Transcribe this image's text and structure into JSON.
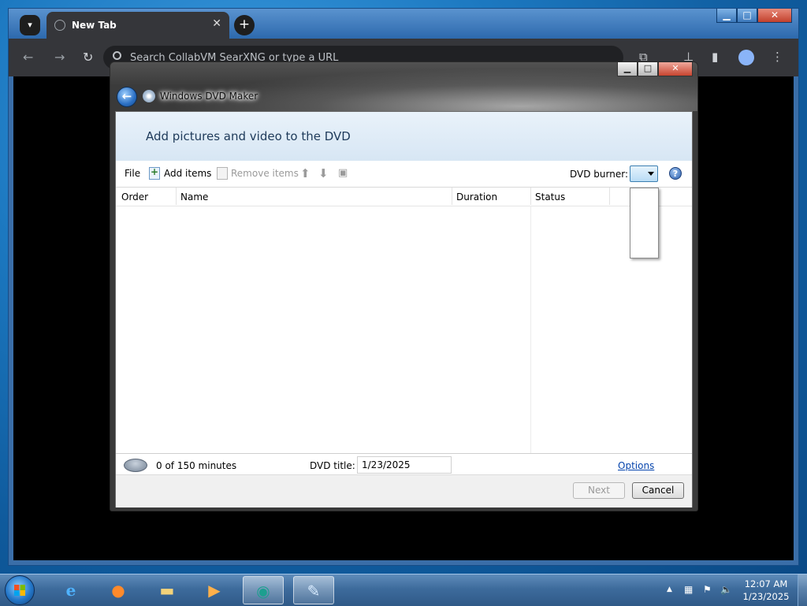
{
  "browser": {
    "tab_title": "New Tab",
    "omnibox_placeholder": "Search CollabVM SearXNG or type a URL",
    "window_buttons": {
      "minimize": "▁",
      "maximize": "□",
      "close": "✕"
    }
  },
  "dvd_maker": {
    "window_title": "Windows DVD Maker",
    "caption_buttons": {
      "minimize": "▁",
      "maximize": "□",
      "close": "✕"
    },
    "heading": "Add pictures and video to the DVD",
    "commands": {
      "file": "File",
      "add_items": "Add items",
      "remove_items": "Remove items"
    },
    "burner_label": "DVD burner:",
    "help": "?",
    "columns": [
      "Order",
      "Name",
      "Duration",
      "Status"
    ],
    "footer": {
      "minutes": "0 of 150 minutes",
      "title_label": "DVD title:",
      "title_value": "1/23/2025",
      "options": "Options"
    },
    "buttons": {
      "next": "Next",
      "cancel": "Cancel"
    }
  },
  "taskbar": {
    "apps": [
      "internet-explorer",
      "firefox",
      "windows-explorer",
      "media-player",
      "collabvm-app",
      "dvd-maker"
    ],
    "clock_time": "12:07 AM",
    "clock_date": "1/23/2025"
  },
  "colors": {
    "accent": "#3c7fb1",
    "link": "#0645ad",
    "header_band": "#e2eef8"
  }
}
